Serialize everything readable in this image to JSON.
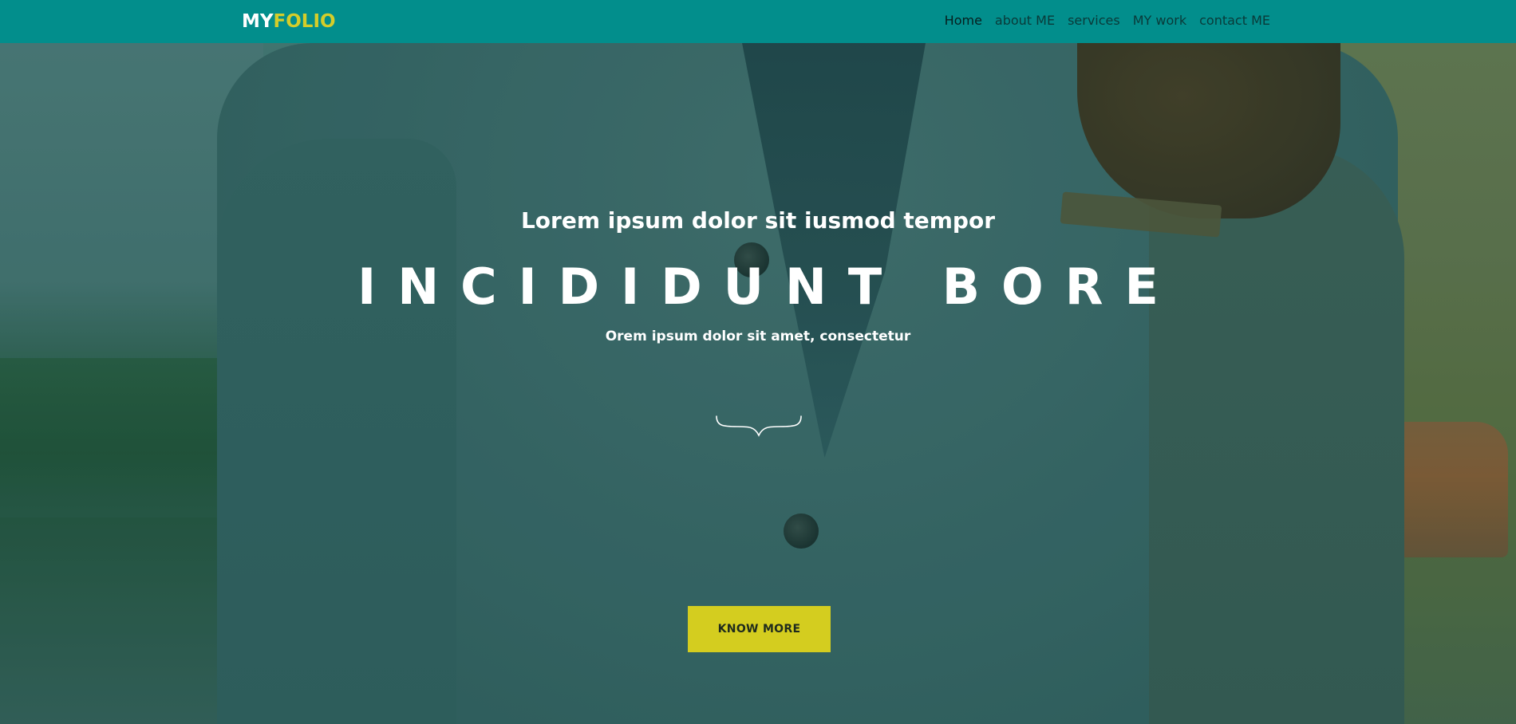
{
  "navbar": {
    "brand_part1": "MY",
    "brand_part2": "FOLIO",
    "items": [
      {
        "label": "Home",
        "active": true
      },
      {
        "label": "about ME",
        "active": false
      },
      {
        "label": "services",
        "active": false
      },
      {
        "label": "MY work",
        "active": false
      },
      {
        "label": "contact ME",
        "active": false
      }
    ]
  },
  "hero": {
    "kicker": "Lorem ipsum dolor sit iusmod tempor",
    "headline": "INCIDIDUNT BORE",
    "subline": "Orem ipsum dolor sit amet, consectetur",
    "cta_label": "KNOW MORE"
  },
  "colors": {
    "navbar_bg": "#028e8c",
    "brand_accent": "#d4cd2a",
    "cta_bg": "#d4cd1f",
    "hero_text": "#ffffff"
  }
}
